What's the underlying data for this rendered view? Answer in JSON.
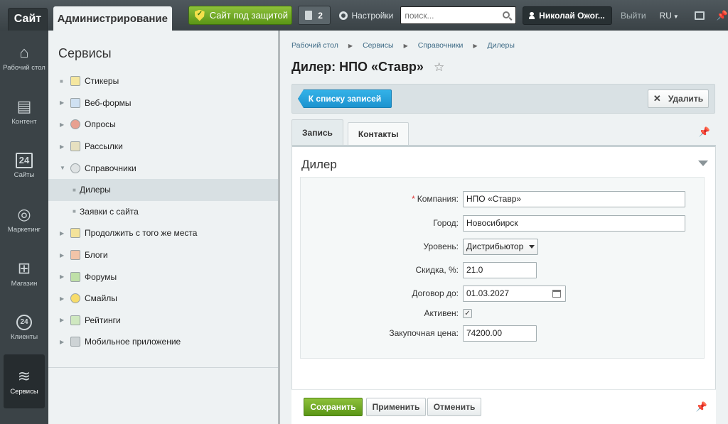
{
  "topbar": {
    "site_tab": "Сайт",
    "admin_tab": "Администрирование",
    "protect_label": "Сайт под защитой",
    "notif_count": "2",
    "settings_label": "Настройки",
    "search_placeholder": "поиск...",
    "user_name": "Николай Ожог...",
    "logout_label": "Выйти",
    "lang_label": "RU"
  },
  "rail": [
    {
      "label": "Рабочий стол",
      "icon": "home-icon"
    },
    {
      "label": "Контент",
      "icon": "document-icon"
    },
    {
      "label": "Сайты",
      "icon": "calendar-icon"
    },
    {
      "label": "Маркетинг",
      "icon": "target-icon"
    },
    {
      "label": "Магазин",
      "icon": "basket-icon"
    },
    {
      "label": "Клиенты",
      "icon": "clients-icon"
    },
    {
      "label": "Сервисы",
      "icon": "layers-icon"
    }
  ],
  "services": {
    "title": "Сервисы",
    "items": [
      {
        "label": "Стикеры"
      },
      {
        "label": "Веб-формы"
      },
      {
        "label": "Опросы"
      },
      {
        "label": "Рассылки"
      },
      {
        "label": "Справочники"
      },
      {
        "label": "Дилеры"
      },
      {
        "label": "Заявки с сайта"
      },
      {
        "label": "Продолжить с того же места"
      },
      {
        "label": "Блоги"
      },
      {
        "label": "Форумы"
      },
      {
        "label": "Смайлы"
      },
      {
        "label": "Рейтинги"
      },
      {
        "label": "Мобильное приложение"
      }
    ]
  },
  "breadcrumbs": [
    "Рабочий стол",
    "Сервисы",
    "Справочники",
    "Дилеры"
  ],
  "page_title": "Дилер: НПО «Ставр»",
  "toolbar": {
    "back_label": "К списку записей",
    "delete_label": "Удалить"
  },
  "tabs": [
    "Запись",
    "Контакты"
  ],
  "card_title": "Дилер",
  "form": {
    "company_label": "Компания:",
    "company_value": "НПО «Ставр»",
    "city_label": "Город:",
    "city_value": "Новосибирск",
    "level_label": "Уровень:",
    "level_value": "Дистрибьютор",
    "discount_label": "Скидка, %:",
    "discount_value": "21.0",
    "contract_label": "Договор до:",
    "contract_value": "01.03.2027",
    "active_label": "Активен:",
    "active_checked": true,
    "price_label": "Закупочная цена:",
    "price_value": "74200.00"
  },
  "footer": {
    "save_label": "Сохранить",
    "apply_label": "Применить",
    "cancel_label": "Отменить"
  },
  "colors": {
    "accent_green": "#6aa823",
    "accent_blue": "#27a3dc",
    "dark_bar": "#3b4347"
  }
}
